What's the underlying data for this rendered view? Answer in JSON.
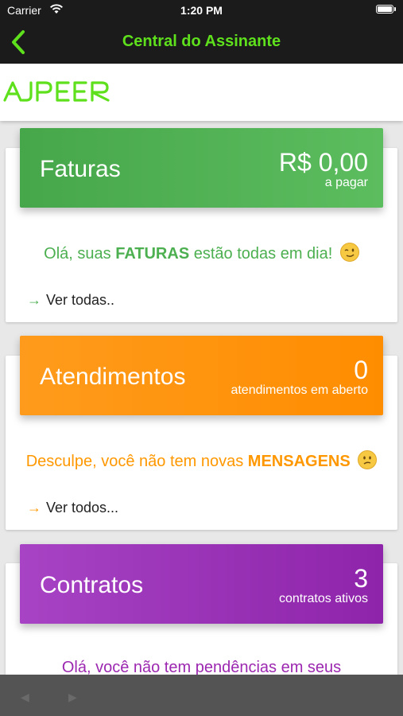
{
  "status_bar": {
    "carrier": "Carrier",
    "time": "1:20 PM"
  },
  "nav": {
    "title": "Central do Assinante"
  },
  "brand": {
    "logo_text": "AJPEER",
    "logo_color": "#5ee01c"
  },
  "cards": {
    "faturas": {
      "title": "Faturas",
      "value": "R$ 0,00",
      "sub": "a pagar",
      "msg_pre": "Olá, suas ",
      "msg_bold": "FATURAS",
      "msg_post": " estão todas em dia!",
      "emoji": "winking-face",
      "link": "Ver todas..",
      "color": "#4caf50"
    },
    "atendimentos": {
      "title": "Atendimentos",
      "value": "0",
      "sub": "atendimentos em aberto",
      "msg_pre": "Desculpe, você não tem novas ",
      "msg_bold": "MENSAGENS",
      "emoji": "confused-face",
      "link": "Ver todos...",
      "color": "#ff9800"
    },
    "contratos": {
      "title": "Contratos",
      "value": "3",
      "sub": "contratos ativos",
      "msg": "Olá, você não tem pendências em seus",
      "color": "#9c27b0"
    }
  }
}
